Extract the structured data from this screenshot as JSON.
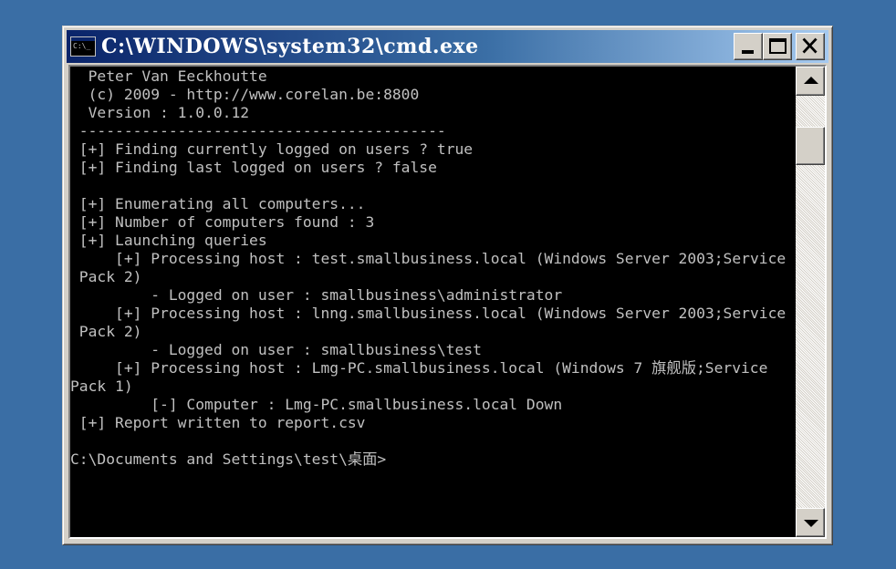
{
  "window": {
    "title": "C:\\WINDOWS\\system32\\cmd.exe",
    "icon": "cmd-console-icon",
    "icon_text": "C:\\_"
  },
  "console": {
    "text_color": "#c0c0c0",
    "background": "#000000",
    "lines": [
      "  Peter Van Eeckhoutte",
      "  (c) 2009 - http://www.corelan.be:8800",
      "  Version : 1.0.0.12",
      " -----------------------------------------",
      " [+] Finding currently logged on users ? true",
      " [+] Finding last logged on users ? false",
      "",
      " [+] Enumerating all computers...",
      " [+] Number of computers found : 3",
      " [+] Launching queries",
      "     [+] Processing host : test.smallbusiness.local (Windows Server 2003;Service",
      " Pack 2)",
      "         - Logged on user : smallbusiness\\administrator",
      "     [+] Processing host : lnng.smallbusiness.local (Windows Server 2003;Service",
      " Pack 2)",
      "         - Logged on user : smallbusiness\\test",
      "     [+] Processing host : Lmg-PC.smallbusiness.local (Windows 7 旗舰版;Service",
      "Pack 1)",
      "         [-] Computer : Lmg-PC.smallbusiness.local Down",
      " [+] Report written to report.csv",
      "",
      "C:\\Documents and Settings\\test\\桌面>"
    ]
  },
  "colors": {
    "desktop": "#3a6ea5",
    "title_gradient_start": "#0a246a",
    "title_gradient_end": "#a6caf0",
    "window_face": "#d4d0c8"
  }
}
